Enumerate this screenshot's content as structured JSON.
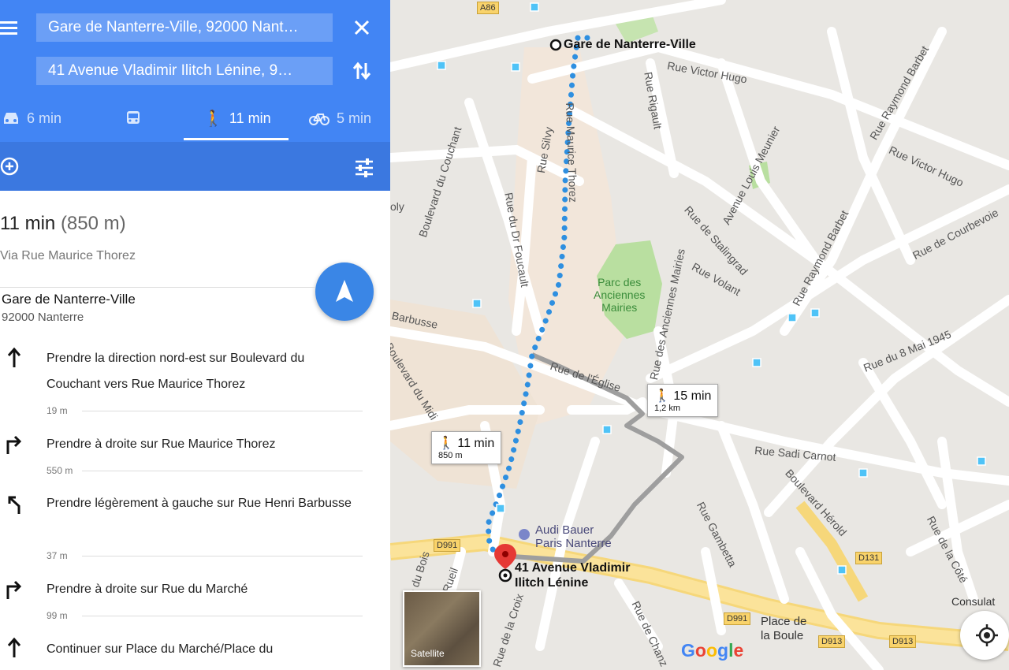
{
  "search": {
    "from": "Gare de Nanterre-Ville, 92000 Nant…",
    "to": "41 Avenue Vladimir Ilitch Lénine, 9…"
  },
  "modes": [
    {
      "icon": "car-icon",
      "label": "6 min"
    },
    {
      "icon": "transit-icon",
      "label": ""
    },
    {
      "icon": "walk-icon",
      "label": "11 min",
      "selected": true
    },
    {
      "icon": "bike-icon",
      "label": "5 min"
    }
  ],
  "summary": {
    "time": "11 min",
    "distance": "(850 m)",
    "via": "Via Rue Maurice Thorez"
  },
  "start": {
    "name": "Gare de Nanterre-Ville",
    "city": "92000 Nanterre"
  },
  "steps": [
    {
      "icon": "arrow-up-icon",
      "text": "Prendre la direction nord-est sur Boulevard du Couchant vers Rue Maurice Thorez",
      "distance": "19 m"
    },
    {
      "icon": "turn-right-icon",
      "text": "Prendre à droite sur Rue Maurice Thorez",
      "distance": "550 m"
    },
    {
      "icon": "slight-left-icon",
      "text": "Prendre légèrement à gauche sur Rue Henri Barbusse",
      "distance": "37 m"
    },
    {
      "icon": "turn-right-icon",
      "text": "Prendre à droite sur Rue du Marché",
      "distance": "99 m"
    },
    {
      "icon": "arrow-up-icon",
      "text": "Continuer sur Place du Marché/Place du",
      "distance": ""
    }
  ],
  "map": {
    "origin_label": "Gare de Nanterre-Ville",
    "destination_label_1": "41 Avenue Vladimir",
    "destination_label_2": "Ilitch Lénine",
    "route_main": {
      "time": "11 min",
      "distance": "850 m"
    },
    "route_alt": {
      "time": "15 min",
      "distance": "1,2 km"
    },
    "poi_audi_1": "Audi Bauer",
    "poi_audi_2": "Paris Nanterre",
    "park_1": "Parc des",
    "park_2": "Anciennes",
    "park_3": "Mairies",
    "place_1": "Place de",
    "place_2": "la Boule",
    "consulat": "Consulat",
    "satellite": "Satellite",
    "streets": {
      "victor_hugo_1": "Rue Victor Hugo",
      "victor_hugo_2": "Rue Victor Hugo",
      "raymond_barbet_1": "Rue Raymond Barbet",
      "raymond_barbet_2": "Rue Raymond Barbet",
      "louis_meunier": "Avenue Louis Meunier",
      "rigault": "Rue Rigault",
      "silvy": "Rue Silvy",
      "couchant": "Boulevard du Couchant",
      "foucault": "Rue du Dr Foucault",
      "maurice_thorez": "Rue Maurice Thorez",
      "stalingrad": "Rue de Stalingrad",
      "volant": "Rue Volant",
      "anciennes_mairies": "Rue des Anciennes Mairies",
      "courbevoie": "Rue de Courbevoie",
      "mai_1945": "Rue du 8 Mai 1945",
      "eglise": "Rue de l'Église",
      "sadi_carnot": "Rue Sadi Carnot",
      "herold": "Boulevard Hérold",
      "gambetta": "Rue Gambetta",
      "cote": "Rue de la Côté",
      "bois": "Rue du Bois",
      "rueil": "Rueil",
      "croix": "Rue de la Croix",
      "chanz": "Rue de Chanz",
      "midi": "Boulevard du Midi",
      "barbusse": "Barbusse",
      "oly": "oly"
    },
    "shields": [
      "A86",
      "D991",
      "D991",
      "D913",
      "D913",
      "D131"
    ]
  },
  "colors": {
    "header_blue": "#4285f4",
    "route_blue": "#2e8fe0",
    "route_alt": "#9e9e9e",
    "park_green": "#b9dfa0",
    "pin_red": "#e53935"
  }
}
